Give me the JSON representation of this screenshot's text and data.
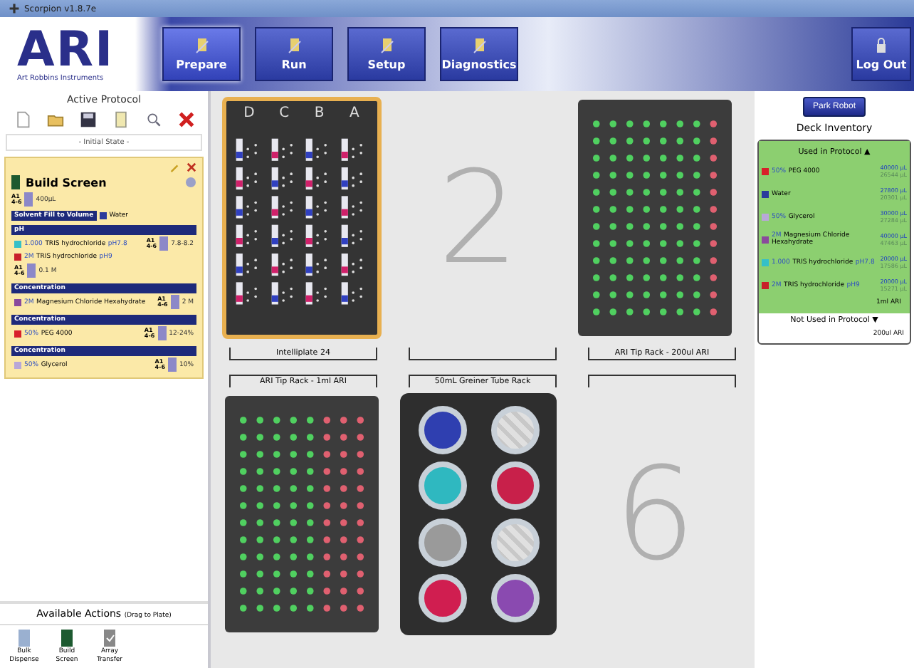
{
  "window": {
    "title": "Scorpion v1.8.7e"
  },
  "logo": {
    "letters": "ARI",
    "subtitle": "Art Robbins Instruments"
  },
  "nav": [
    {
      "label": "Prepare",
      "selected": true
    },
    {
      "label": "Run",
      "selected": false
    },
    {
      "label": "Setup",
      "selected": false
    },
    {
      "label": "Diagnostics",
      "selected": false
    }
  ],
  "logout": "Log Out",
  "protocol": {
    "heading": "Active Protocol",
    "state": "- Initial State -",
    "step": {
      "title": "Build Screen",
      "wells": "A1",
      "range": "4-6",
      "volume": "400µL"
    },
    "sections": [
      {
        "kind": "solvent",
        "title": "Solvent Fill to Volume",
        "rows": [
          {
            "kind": "reagent",
            "color": "#2b3a9c",
            "name": "Water"
          }
        ]
      },
      {
        "kind": "group",
        "title": "pH",
        "rows": [
          {
            "kind": "reagent",
            "color": "#35c0c8",
            "conc": "1.000",
            "name": "TRIS hydrochloride",
            "ph": "pH7.8",
            "wells": "A1",
            "range": "4-6",
            "amount": "7.8-8.2"
          },
          {
            "kind": "reagent",
            "color": "#c8202a",
            "conc": "2M",
            "name": "TRIS hydrochloride",
            "ph": "pH9"
          },
          {
            "kind": "amount",
            "wells": "A1",
            "range": "4-6",
            "amount": "0.1 M"
          }
        ]
      },
      {
        "kind": "group",
        "title": "Concentration",
        "rows": [
          {
            "kind": "reagent",
            "color": "#8a4a9c",
            "conc": "2M",
            "name": "Magnesium Chloride Hexahydrate",
            "wells": "A1",
            "range": "4-6",
            "amount": "2 M"
          }
        ]
      },
      {
        "kind": "group",
        "title": "Concentration",
        "rows": [
          {
            "kind": "reagent",
            "color": "#d8202a",
            "conc": "50%",
            "name": "PEG 4000",
            "wells": "A1",
            "range": "4-6",
            "amount": "12-24%"
          }
        ]
      },
      {
        "kind": "group",
        "title": "Concentration",
        "rows": [
          {
            "kind": "reagent",
            "color": "#b8a8d8",
            "conc": "50%",
            "name": "Glycerol",
            "wells": "A1",
            "range": "4-6",
            "amount": "10%"
          }
        ]
      }
    ]
  },
  "actions": {
    "heading": "Available Actions",
    "hint": "(Drag to Plate)",
    "items": [
      {
        "label": "Bulk Dispense",
        "kind": "bulk"
      },
      {
        "label": "Build Screen",
        "kind": "build"
      },
      {
        "label": "Array Transfer",
        "kind": "array"
      }
    ]
  },
  "deck": {
    "top": [
      {
        "kind": "intelliplate",
        "selected": true,
        "label": "Intelliplate 24",
        "columns": [
          "D",
          "C",
          "B",
          "A"
        ]
      },
      {
        "kind": "empty",
        "number": "2"
      },
      {
        "kind": "tiprack",
        "label": "ARI Tip Rack - 200ul ARI",
        "tip_columns": [
          {
            "used": false
          },
          {
            "used": false
          },
          {
            "used": false
          },
          {
            "used": false
          },
          {
            "used": false
          },
          {
            "used": false
          },
          {
            "used": false
          },
          {
            "used": true
          }
        ]
      }
    ],
    "bottom": [
      {
        "kind": "tiprack",
        "label": "ARI Tip Rack - 1ml ARI",
        "tip_columns": [
          {
            "used": false
          },
          {
            "used": false
          },
          {
            "used": false
          },
          {
            "used": false
          },
          {
            "used": false
          },
          {
            "used": true
          },
          {
            "used": true
          },
          {
            "used": true
          }
        ]
      },
      {
        "kind": "tuberack",
        "label": "50mL Greiner Tube Rack",
        "tubes": [
          {
            "kind": "filled",
            "color": "#2f3fb0"
          },
          {
            "kind": "empty"
          },
          {
            "kind": "filled",
            "color": "#2fb8c0"
          },
          {
            "kind": "filled",
            "color": "#c8204a"
          },
          {
            "kind": "filled",
            "color": "#9a9a9a"
          },
          {
            "kind": "empty"
          },
          {
            "kind": "filled",
            "color": "#d01e50"
          },
          {
            "kind": "filled",
            "color": "#8a4ab0"
          }
        ]
      },
      {
        "kind": "empty",
        "number": "6"
      }
    ]
  },
  "inventory": {
    "park": "Park Robot",
    "heading": "Deck Inventory",
    "used": {
      "title": "Used in Protocol ▲",
      "items": [
        {
          "color": "#d8202a",
          "conc": "50%",
          "name": "PEG 4000",
          "amount": "40000 µL",
          "remaining": "26544 µL"
        },
        {
          "color": "#2b3a9c",
          "name": "Water",
          "amount": "27800 µL",
          "remaining": "20301 µL"
        },
        {
          "color": "#b8a8d8",
          "conc": "50%",
          "name": "Glycerol",
          "amount": "30000 µL",
          "remaining": "27284 µL"
        },
        {
          "color": "#8a4a9c",
          "conc": "2M",
          "name": "Magnesium Chloride Hexahydrate",
          "amount": "40000 µL",
          "remaining": "47463 µL"
        },
        {
          "color": "#35c0c8",
          "conc": "1.000",
          "name": "TRIS hydrochloride",
          "ph": "pH7.8",
          "amount": "20000 µL",
          "remaining": "17586 µL"
        },
        {
          "color": "#c8202a",
          "conc": "2M",
          "name": "TRIS hydrochloride",
          "ph": "pH9",
          "amount": "20000 µL",
          "remaining": "15271 µL"
        }
      ],
      "tip": "1ml ARI"
    },
    "unused": {
      "title": "Not Used in Protocol ▼",
      "tip": "200ul ARI"
    }
  }
}
